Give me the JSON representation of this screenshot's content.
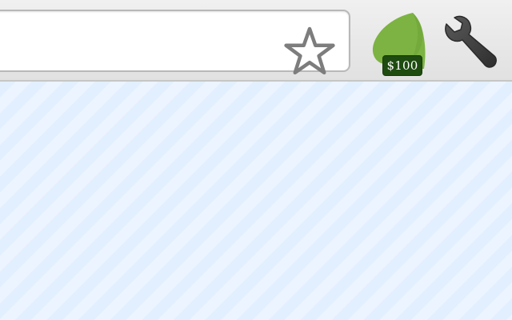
{
  "toolbar": {
    "omnibox": {
      "value": "",
      "placeholder": ""
    },
    "bookmark_star": {
      "icon": "star-outline-icon"
    },
    "extension": {
      "icon": "leaf-icon",
      "badge_text": "$100",
      "leaf_color": "#7cb342",
      "badge_color": "#1e4b0f"
    },
    "menu": {
      "icon": "wrench-icon"
    }
  },
  "colors": {
    "toolbar_bg": "#e6e6e6",
    "content_bg": "#e2efff"
  }
}
